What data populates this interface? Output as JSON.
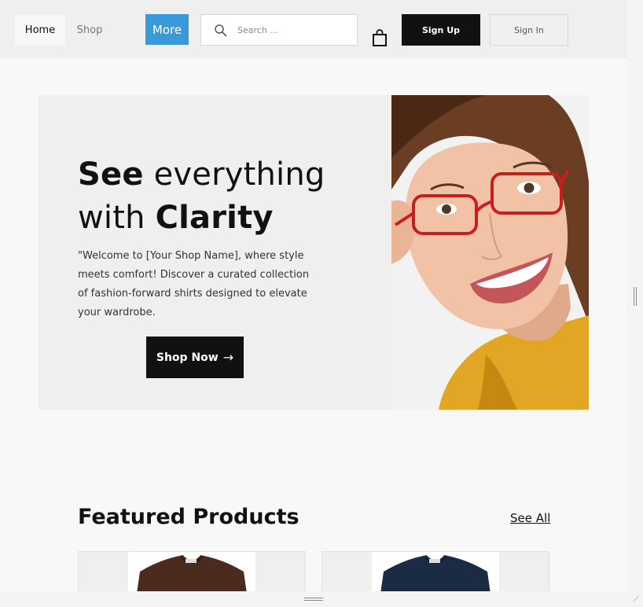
{
  "nav": {
    "home_label": "Home",
    "shop_label": "Shop",
    "more_label": "More",
    "search_placeholder": "Search ...",
    "signup_label": "Sign Up",
    "signin_label": "Sign In",
    "accent_color": "#3a9ad9"
  },
  "hero": {
    "title_bold_1": "See",
    "title_light_1": " everything",
    "title_light_2": "with ",
    "title_bold_2": "Clarity",
    "description": "\"Welcome to [Your Shop Name], where style meets comfort! Discover a curated collection of fashion-forward shirts designed to elevate your wardrobe.",
    "cta_label": "Shop Now",
    "cta_icon": "arrow-right-icon",
    "cta_arrow": "→"
  },
  "featured": {
    "title": "Featured Products",
    "see_all_label": "See All",
    "products": [
      {
        "color": "#4a2b1e"
      },
      {
        "color": "#1c2b44"
      }
    ]
  }
}
